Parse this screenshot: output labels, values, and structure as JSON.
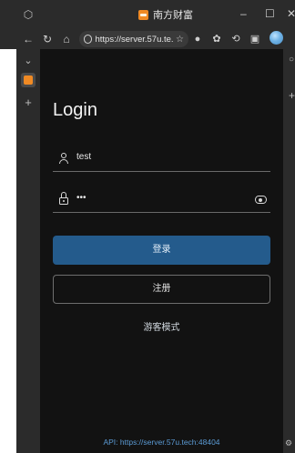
{
  "browser": {
    "tab_title": "南方财富",
    "url": "https://server.57u.te...",
    "icons": {
      "window_menu": "window-icon",
      "back": "arrow-left-icon",
      "refresh": "refresh-icon",
      "home": "home-icon",
      "favorite": "star-icon",
      "extension": "puzzle-icon",
      "history": "history-icon",
      "screenshot": "screenshot-icon",
      "profile": "profile-avatar"
    },
    "window_controls": {
      "minimize": "–",
      "maximize": "☐",
      "close": "✕"
    }
  },
  "sidebar": {
    "chevron": "chevron-down-icon",
    "add": "+"
  },
  "login": {
    "title": "Login",
    "username_value": "test",
    "password_value": "•••",
    "login_button": "登录",
    "register_button": "注册",
    "guest_mode": "游客模式",
    "api_label": "API: https://server.57u.tech:48404"
  },
  "colors": {
    "background": "#121212",
    "primary": "#245b8c",
    "api_link": "#5b9bd5",
    "favicon": "#f08a24"
  }
}
